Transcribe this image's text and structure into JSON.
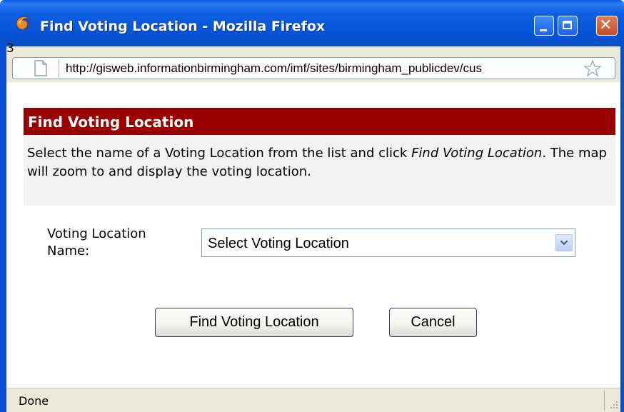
{
  "window": {
    "title": "Find Voting Location - Mozilla Firefox",
    "stray_label": "3"
  },
  "location_bar": {
    "url": "http://gisweb.informationbirmingham.com/imf/sites/birmingham_publicdev/cus"
  },
  "panel": {
    "header": "Find Voting Location",
    "description_part1": "Select the name of a Voting Location from the list and click ",
    "description_emphasis": "Find Voting Location",
    "description_part2": ". The map will zoom to and display the voting location."
  },
  "form": {
    "label": "Voting Location Name:",
    "select_value": "Select Voting Location",
    "find_button": "Find Voting Location",
    "cancel_button": "Cancel"
  },
  "status": {
    "text": "Done"
  },
  "colors": {
    "titlebar": "#0653d8",
    "header_bg": "#990000",
    "desc_bg": "#f2f2f2",
    "chrome_bg": "#ece9d8"
  },
  "icons": {
    "app": "firefox-icon",
    "page": "page-icon",
    "bookmark": "star-icon",
    "dropdown": "chevron-down-icon",
    "resize": "resize-grip-icon"
  }
}
